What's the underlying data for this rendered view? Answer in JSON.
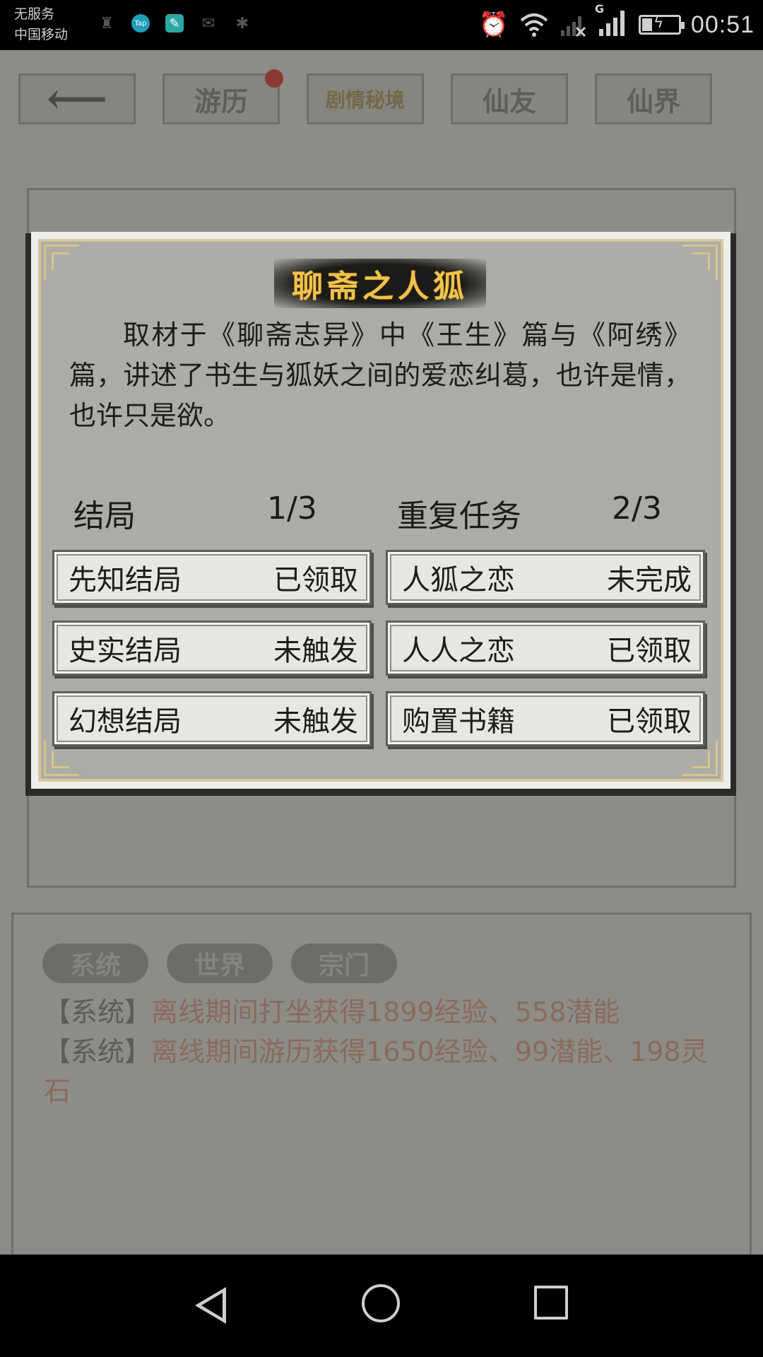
{
  "status_bar": {
    "carrier_line1": "无服务",
    "carrier_line2": "中国移动",
    "left_icons": [
      "notification-app-icon",
      "taptap-icon",
      "pen-icon",
      "message-icon",
      "settings-icon"
    ],
    "taptap_label": "Tap",
    "network_type": "G",
    "time": "00:51"
  },
  "top_nav": {
    "back_label": "⟵",
    "tabs": [
      "游历",
      "剧情秘境",
      "仙友",
      "仙界"
    ]
  },
  "chat": {
    "tabs": [
      "系统",
      "世界",
      "宗门"
    ],
    "messages": [
      {
        "tag": "【系统】",
        "text": "离线期间打坐获得1899经验、558潜能"
      },
      {
        "tag": "【系统】",
        "text": "离线期间游历获得1650经验、99潜能、198灵石"
      }
    ]
  },
  "dialog": {
    "title": "聊斋之人狐",
    "description": "取材于《聊斋志异》中《王生》篇与《阿绣》篇，讲述了书生与狐妖之间的爱恋纠葛，也许是情，也许只是欲。",
    "endings": {
      "label": "结局",
      "progress": "1/3",
      "items": [
        {
          "name": "先知结局",
          "status": "已领取"
        },
        {
          "name": "史实结局",
          "status": "未触发"
        },
        {
          "name": "幻想结局",
          "status": "未触发"
        }
      ]
    },
    "repeat_tasks": {
      "label": "重复任务",
      "progress": "2/3",
      "items": [
        {
          "name": "人狐之恋",
          "status": "未完成"
        },
        {
          "name": "人人之恋",
          "status": "已领取"
        },
        {
          "name": "购置书籍",
          "status": "已领取"
        }
      ]
    }
  },
  "colors": {
    "title_gold": "#f1c34a",
    "dialog_bg": "#acaba6",
    "button_bg": "#e7e6e2",
    "chat_message": "#8a6a5c"
  }
}
